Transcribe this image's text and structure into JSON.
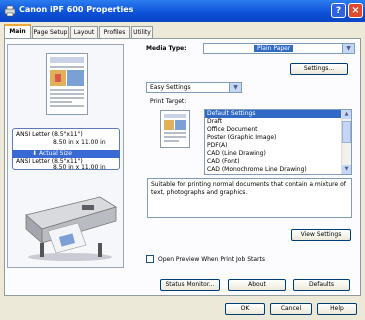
{
  "window": {
    "title": "Canon iPF 600 Properties",
    "help_label": "?",
    "close_label": "×"
  },
  "tabs": [
    "Main",
    "Page Setup",
    "Layout",
    "Profiles",
    "Utility"
  ],
  "preview": {
    "size_line1": "ANSI Letter (8.5\"x11\")",
    "size_line2": "8.50 in x 11.00 in",
    "arrow_label": "Actual Size",
    "size_line3": "ANSI Letter (8.5\"x11\")",
    "size_line4": "8.50 in x 11.00 in"
  },
  "media": {
    "label": "Media Type:",
    "value": "Plain Paper",
    "settings_button": "Settings..."
  },
  "settings_mode": {
    "value": "Easy Settings"
  },
  "print_target": {
    "label": "Print Target:",
    "items": [
      "Default Settings",
      "Draft",
      "Office Document",
      "Poster (Graphic Image)",
      "PDF(A)",
      "CAD (Line Drawing)",
      "CAD (Font)",
      "CAD (Monochrome Line Drawing)"
    ],
    "selected_index": 0
  },
  "description": "Suitable for printing normal documents that contain a mixture of text, photographs and graphics.",
  "view_settings_button": "View Settings",
  "open_preview": {
    "label": "Open Preview When Print Job Starts",
    "checked": false
  },
  "footer_buttons": {
    "status_monitor": "Status Monitor...",
    "about": "About",
    "defaults": "Defaults"
  },
  "dialog_buttons": {
    "ok": "OK",
    "cancel": "Cancel",
    "help": "Help"
  },
  "colors": {
    "titlebar": "#0b4fd6",
    "selection": "#316ac5",
    "face": "#ece9d8"
  }
}
